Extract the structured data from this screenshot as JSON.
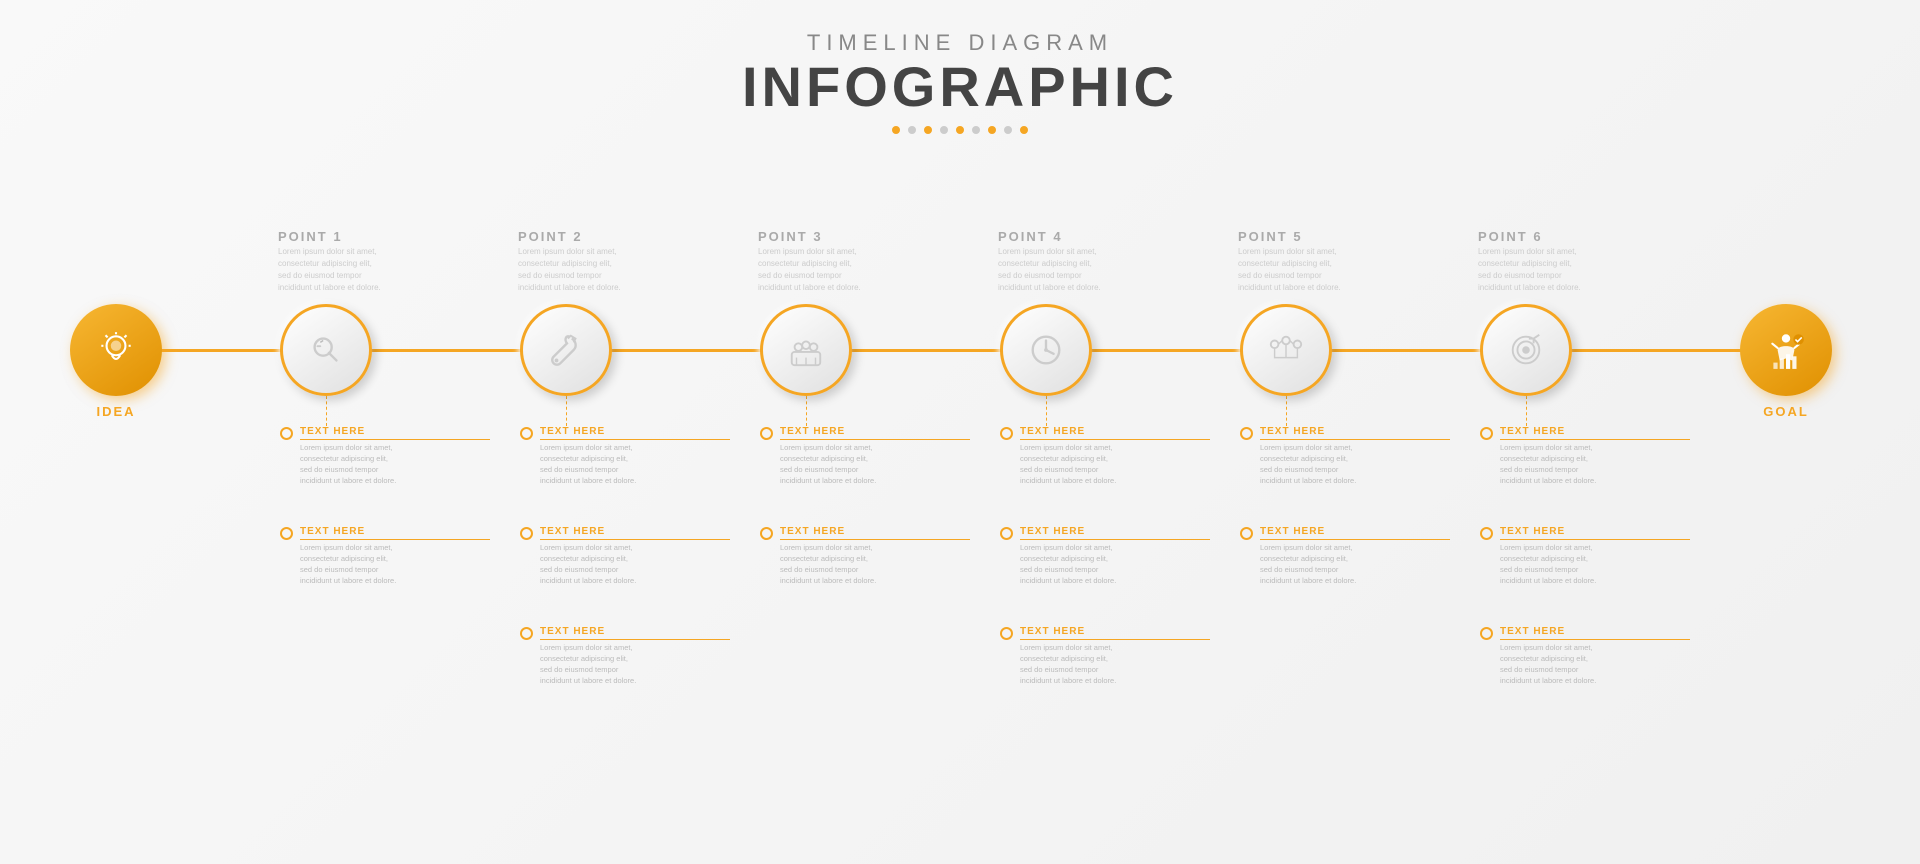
{
  "header": {
    "subtitle": "Timeline Diagram",
    "title": "INFOGRAPHIC",
    "dots": [
      1,
      2,
      3,
      4,
      5,
      6,
      7,
      8,
      9
    ]
  },
  "nodes": [
    {
      "id": "idea",
      "label": "IDEA",
      "icon": "idea",
      "type": "orange"
    },
    {
      "id": "n1",
      "label": "",
      "icon": "search-bar",
      "type": "normal",
      "point": "POINT 1"
    },
    {
      "id": "n2",
      "label": "",
      "icon": "wrench",
      "type": "normal",
      "point": "POINT 2"
    },
    {
      "id": "n3",
      "label": "",
      "icon": "team",
      "type": "normal",
      "point": "POINT 3"
    },
    {
      "id": "n4",
      "label": "",
      "icon": "clock",
      "type": "normal",
      "point": "POINT 4"
    },
    {
      "id": "n5",
      "label": "",
      "icon": "process",
      "type": "normal",
      "point": "POINT 5"
    },
    {
      "id": "n6",
      "label": "",
      "icon": "target",
      "type": "normal",
      "point": "POINT 6"
    },
    {
      "id": "goal",
      "label": "GOAL",
      "icon": "goal",
      "type": "orange"
    }
  ],
  "lorem": "Lorem ipsum dolor sit amet, consectetur adipiscing elit, sed do eiusmod tempor incididunt ut labore et dolore.",
  "text_here": "TEXT HERE",
  "point_desc": "Lorem ipsum dolor sit amet, consectetur adipiscing elit, sed do eiusmod tempor incididunt ut labore et dolore."
}
